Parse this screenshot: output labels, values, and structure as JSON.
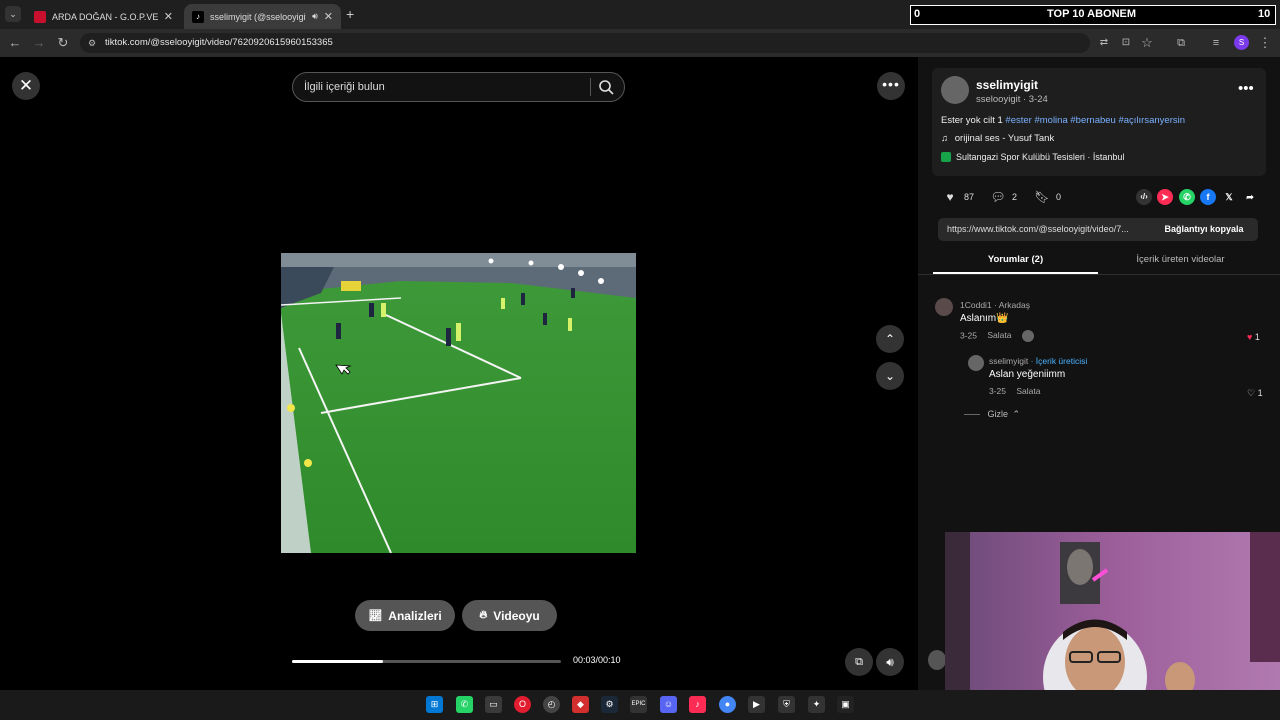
{
  "browser": {
    "tabs": [
      {
        "title": "ARDA DOĞAN - G.O.P.VENÜS",
        "close": "✕"
      },
      {
        "title": "sselimyigit (@sselooyigit) |",
        "close": "✕"
      }
    ],
    "new_tab": "+",
    "url": "tiktok.com/@sselooyigit/video/7620920615960153365"
  },
  "overlay_banner": {
    "left_value": "0",
    "title": "TOP 10 ABONEM",
    "right_value": "10"
  },
  "player": {
    "close_symbol": "✕",
    "search_placeholder": "İlgili içeriği bulun",
    "more_symbol": "•••",
    "analytics_button": "Analizleri",
    "promote_button": "Videoyu",
    "time": "00:03/00:10",
    "progress_fraction": 0.34
  },
  "post": {
    "username": "sselimyigit",
    "handle_date": "sselooyigit · 3-24",
    "more_symbol": "•••",
    "caption_text": "Ester yok cilt 1 ",
    "hashtags": [
      "#ester",
      "#molina",
      "#bernabeu",
      "#açılırsanyersin"
    ],
    "sound": "orijinal ses - Yusuf Tank",
    "location": "Sultangazi Spor Kulübü Tesisleri · İstanbul",
    "likes": "87",
    "comments": "2",
    "saves": "0",
    "link": "https://www.tiktok.com/@sselooyigit/video/7...",
    "copy_button": "Bağlantıyı kopyala",
    "tab_comments": "Yorumlar (2)",
    "tab_creator_videos": "İçerik üreten videolar"
  },
  "comments": [
    {
      "author": "1Coddi1",
      "tag": " · Arkadaş",
      "text": "Aslanım👑",
      "date": "3-25",
      "reply_label": "Salata",
      "likes": "1",
      "liked": true
    },
    {
      "author": "sselimyigit",
      "tag": " · İçerik üreticisi",
      "text": "Aslan yeğeniimm",
      "date": "3-25",
      "reply_label": "Salata",
      "likes": "1",
      "liked": false
    }
  ],
  "hide_replies": "Gizle",
  "colors": {
    "accent_blue": "#7ab0ff",
    "like_red": "#fe2c55",
    "background": "#000000",
    "sidebar": "#121212"
  }
}
